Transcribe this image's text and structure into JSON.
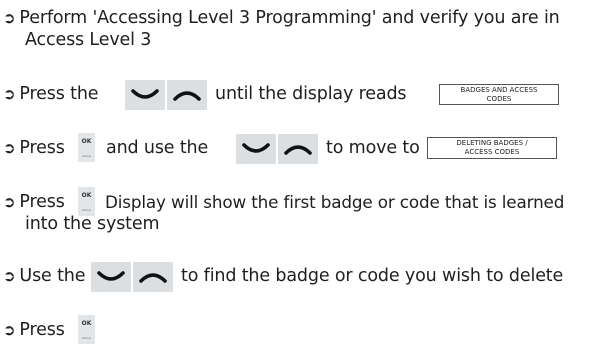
{
  "arrow_glyph": "➲",
  "colors": {
    "key_bg": "#dcdfe1",
    "ok_bg": "#e3e6e8",
    "text": "#1f1f1f"
  },
  "icons": {
    "down_key": "down-arrow-key-icon",
    "up_key": "up-arrow-key-icon",
    "ok_key": "ok-key-icon"
  },
  "ok_key": {
    "label": "OK",
    "sublabel": "status"
  },
  "steps": [
    {
      "line1": "Perform 'Accessing Level 3 Programming' and verify you are in",
      "line2": "Access Level 3"
    },
    {
      "text1": "Press the",
      "text2": "until the display reads",
      "display": [
        "BADGES AND ACCESS",
        "CODES"
      ]
    },
    {
      "text1": "Press",
      "text2": "and use the",
      "text3": "to move to",
      "display": [
        "DELETING BADGES /",
        "ACCESS CODES"
      ]
    },
    {
      "text1": "Press",
      "text2": "Display will show the first badge or code that is learned",
      "line2": "into the system"
    },
    {
      "text1": "Use the",
      "text2": "to find the badge or code you wish to delete"
    },
    {
      "text1": "Press"
    }
  ]
}
